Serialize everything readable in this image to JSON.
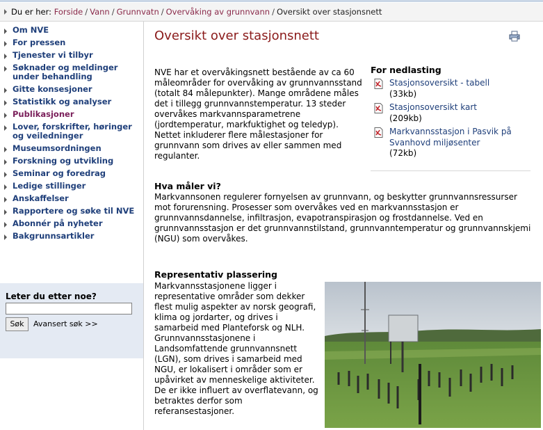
{
  "breadcrumb": {
    "prefix": "Du er her:",
    "links": [
      "Forside",
      "Vann",
      "Grunnvatn",
      "Overvåking av grunnvann"
    ],
    "current": "Oversikt over stasjonsnett"
  },
  "sidebar": {
    "items": [
      {
        "label": "Om NVE"
      },
      {
        "label": "For pressen"
      },
      {
        "label": "Tjenester vi tilbyr"
      },
      {
        "label": "Søknader og meldinger under behandling"
      },
      {
        "label": "Gitte konsesjoner"
      },
      {
        "label": "Statistikk og analyser"
      },
      {
        "label": "Publikasjoner"
      },
      {
        "label": "Lover, forskrifter, høringer og veiledninger"
      },
      {
        "label": "Museumsordningen"
      },
      {
        "label": "Forskning og utvikling"
      },
      {
        "label": "Seminar og foredrag"
      },
      {
        "label": "Ledige stillinger"
      },
      {
        "label": "Anskaffelser"
      },
      {
        "label": "Rapportere og søke til NVE"
      },
      {
        "label": "Abonnér på nyheter"
      },
      {
        "label": "Bakgrunnsartikler"
      }
    ],
    "active_index": 6,
    "search": {
      "label": "Leter du etter noe?",
      "value": "",
      "button": "Søk",
      "advanced": "Avansert søk >>"
    }
  },
  "main": {
    "title": "Oversikt over stasjonsnett",
    "intro": "NVE har et overvåkingsnett bestående av ca 60 måleområder for overvåking av grunnvannsstand (totalt 84 målepunkter). Mange områdene måles det i tillegg grunnvannstemperatur. 13 steder overvåkes markvannsparametrene (jordtemperatur, markfuktighet og teledyp). Nettet inkluderer flere målestasjoner for grunnvann som drives av eller sammen med regulanter.",
    "downloads": {
      "title": "For nedlasting",
      "items": [
        {
          "label": "Stasjonsoversikt - tabell",
          "size": "(33kb)"
        },
        {
          "label": "Stasjonsoversikt kart",
          "size": "(209kb)"
        },
        {
          "label": "Markvannsstasjon i Pasvik på Svanhovd miljøsenter",
          "size": "(72kb)"
        }
      ]
    },
    "section1": {
      "heading": "Hva måler vi?",
      "text": "Markvannsonen regulerer fornyelsen av grunnvann, og beskytter grunnvannsressurser mot forurensning. Prosesser som overvåkes ved en markvannsstasjon er grunnvannsdannelse, infiltrasjon, evapotranspirasjon og frostdannelse. Ved en grunnvannsstasjon er det grunnvannstilstand, grunnvanntemperatur og grunnvannskjemi (NGU) som overvåkes."
    },
    "section2": {
      "heading": "Representativ plassering",
      "text": "Markvannsstasjonene ligger i representative områder som dekker flest mulig aspekter av norsk geografi, klima og jordarter, og drives i samarbeid med Planteforsk og NLH. Grunnvannsstasjonene i Landsomfattende grunnvannsnett (LGN), som drives i samarbeid med NGU, er lokalisert i områder som er upåvirket av menneskelige aktiviteter. De er ikke influert av overflatevann, og betraktes derfor som referansestasjoner."
    }
  },
  "colors": {
    "link": "#1f3f7a",
    "breadcrumb_link": "#8a2a4a",
    "title": "#8a1a1a",
    "active_menu": "#7a1f5a",
    "search_bg": "#e4eaf3"
  },
  "icons": [
    "print-icon",
    "pdf-icon",
    "arrow-right-icon"
  ]
}
